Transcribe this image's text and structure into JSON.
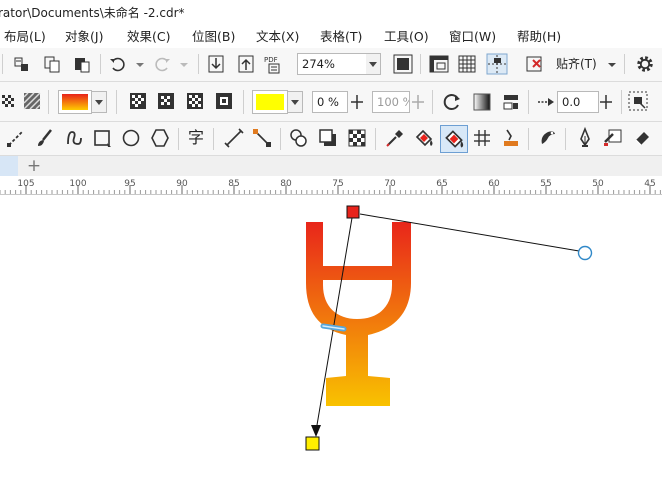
{
  "window": {
    "title": "rator\\Documents\\未命名 -2.cdr*"
  },
  "menu": [
    {
      "label": "布局(L)"
    },
    {
      "label": "对象(J)"
    },
    {
      "label": "效果(C)"
    },
    {
      "label": "位图(B)"
    },
    {
      "label": "文本(X)"
    },
    {
      "label": "表格(T)"
    },
    {
      "label": "工具(O)"
    },
    {
      "label": "窗口(W)"
    },
    {
      "label": "帮助(H)"
    }
  ],
  "standard_toolbar": {
    "zoom_value": "274%",
    "snap_label": "贴齐(T)",
    "pdf_label": "PDF"
  },
  "property_bar": {
    "fill_start_color": "#e8231b",
    "fill_end_color": "#ffcc00",
    "node_color": "#ffff00",
    "node_transparency": "0 %",
    "transparency_dim": "100 %",
    "offset_value": "0.0"
  },
  "toolbox": {
    "text_tool_glyph": "字"
  },
  "ruler": {
    "ticks": [
      "105",
      "100",
      "95",
      "90",
      "85",
      "80",
      "75",
      "70",
      "65",
      "60",
      "55",
      "50",
      "45"
    ]
  },
  "canvas": {
    "gradient_start": "#e8231b",
    "gradient_end": "#f9c300",
    "start_handle_color": "#e8231b",
    "end_handle_color": "#ffee00"
  }
}
